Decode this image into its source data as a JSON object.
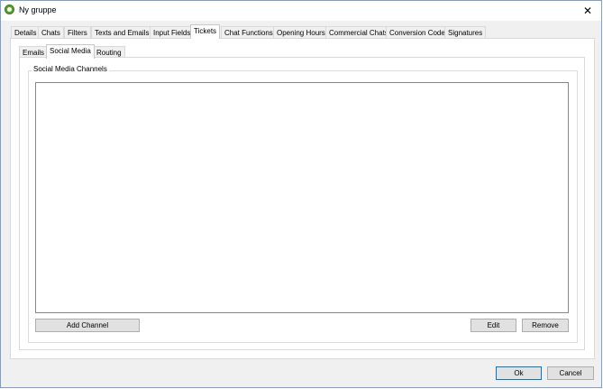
{
  "window": {
    "title": "Ny gruppe",
    "close_glyph": "✕"
  },
  "main_tabs": [
    "Details",
    "Chats",
    "Filters",
    "Texts and Emails",
    "Input Fields",
    "Tickets",
    "Chat Functions",
    "Opening Hours",
    "Commercial Chats",
    "Conversion Code",
    "Signatures"
  ],
  "sub_tabs": [
    "Emails",
    "Social Media",
    "Routing"
  ],
  "group": {
    "label": "Social Media Channels"
  },
  "buttons": {
    "add_channel": "Add Channel",
    "edit": "Edit",
    "remove": "Remove",
    "ok": "Ok",
    "cancel": "Cancel"
  }
}
